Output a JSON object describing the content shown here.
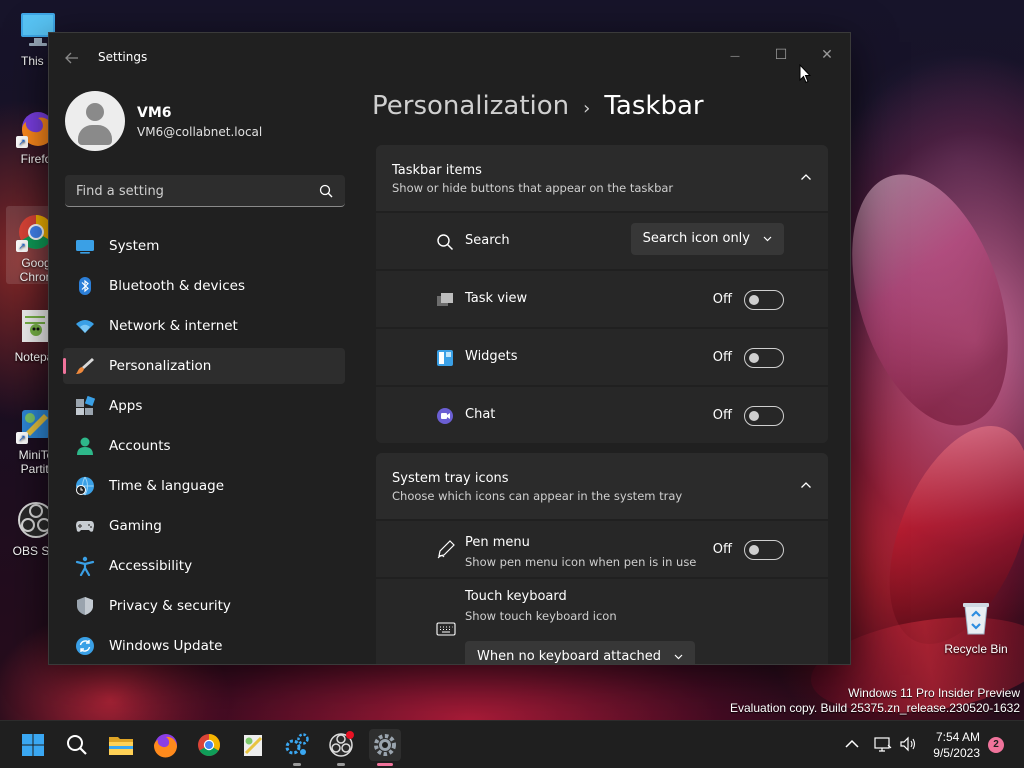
{
  "desktop": {
    "icons": [
      {
        "label": "This P",
        "icon": "monitor-icon"
      },
      {
        "label": "Firefo",
        "icon": "firefox-icon"
      },
      {
        "label": "Goog\nChron",
        "icon": "chrome-icon"
      },
      {
        "label": "Notepa",
        "icon": "notepad-icon"
      },
      {
        "label": "MiniTo\nPartiti",
        "icon": "minitool-icon"
      },
      {
        "label": "OBS Stu",
        "icon": "obs-icon"
      },
      {
        "label": "Recycle Bin",
        "icon": "recycle-bin-icon"
      }
    ],
    "watermark": {
      "line1": "Windows 11 Pro Insider Preview",
      "line2": "Evaluation copy. Build 25375.zn_release.230520-1632"
    }
  },
  "window": {
    "title": "Settings",
    "controls": {
      "minimize": "—",
      "maximize": "☐",
      "close": "✕"
    }
  },
  "profile": {
    "name": "VM6",
    "email": "VM6@collabnet.local"
  },
  "search": {
    "placeholder": "Find a setting"
  },
  "nav": {
    "items": [
      {
        "label": "System",
        "icon": "system-icon"
      },
      {
        "label": "Bluetooth & devices",
        "icon": "bluetooth-icon"
      },
      {
        "label": "Network & internet",
        "icon": "network-icon"
      },
      {
        "label": "Personalization",
        "icon": "personalization-icon",
        "selected": true
      },
      {
        "label": "Apps",
        "icon": "apps-icon"
      },
      {
        "label": "Accounts",
        "icon": "accounts-icon"
      },
      {
        "label": "Time & language",
        "icon": "time-language-icon"
      },
      {
        "label": "Gaming",
        "icon": "gaming-icon"
      },
      {
        "label": "Accessibility",
        "icon": "accessibility-icon"
      },
      {
        "label": "Privacy & security",
        "icon": "privacy-icon"
      },
      {
        "label": "Windows Update",
        "icon": "windows-update-icon"
      }
    ]
  },
  "breadcrumb": {
    "parent": "Personalization",
    "separator": "›",
    "current": "Taskbar"
  },
  "taskbar_items": {
    "title": "Taskbar items",
    "subtitle": "Show or hide buttons that appear on the taskbar",
    "rows": [
      {
        "label": "Search",
        "icon": "search-icon",
        "control": "dropdown",
        "value": "Search icon only"
      },
      {
        "label": "Task view",
        "icon": "task-view-icon",
        "control": "toggle",
        "state": "Off"
      },
      {
        "label": "Widgets",
        "icon": "widgets-icon",
        "control": "toggle",
        "state": "Off"
      },
      {
        "label": "Chat",
        "icon": "chat-icon",
        "control": "toggle",
        "state": "Off"
      }
    ]
  },
  "system_tray": {
    "title": "System tray icons",
    "subtitle": "Choose which icons can appear in the system tray",
    "pen_menu": {
      "label": "Pen menu",
      "description": "Show pen menu icon when pen is in use",
      "state": "Off"
    },
    "touch_keyboard": {
      "label": "Touch keyboard",
      "description": "Show touch keyboard icon",
      "value": "When no keyboard attached"
    }
  },
  "taskbar": {
    "pinned": [
      "start-icon",
      "search-icon",
      "file-explorer-icon",
      "firefox-icon",
      "chrome-icon",
      "notepad-icon",
      "gear-cluster-icon",
      "obs-icon",
      "settings-icon"
    ],
    "time": "7:54 AM",
    "date": "9/5/2023",
    "notification_count": "2"
  },
  "colors": {
    "accent": "#f0739b",
    "window_bg": "#202020",
    "card_bg": "#2b2b2b"
  }
}
